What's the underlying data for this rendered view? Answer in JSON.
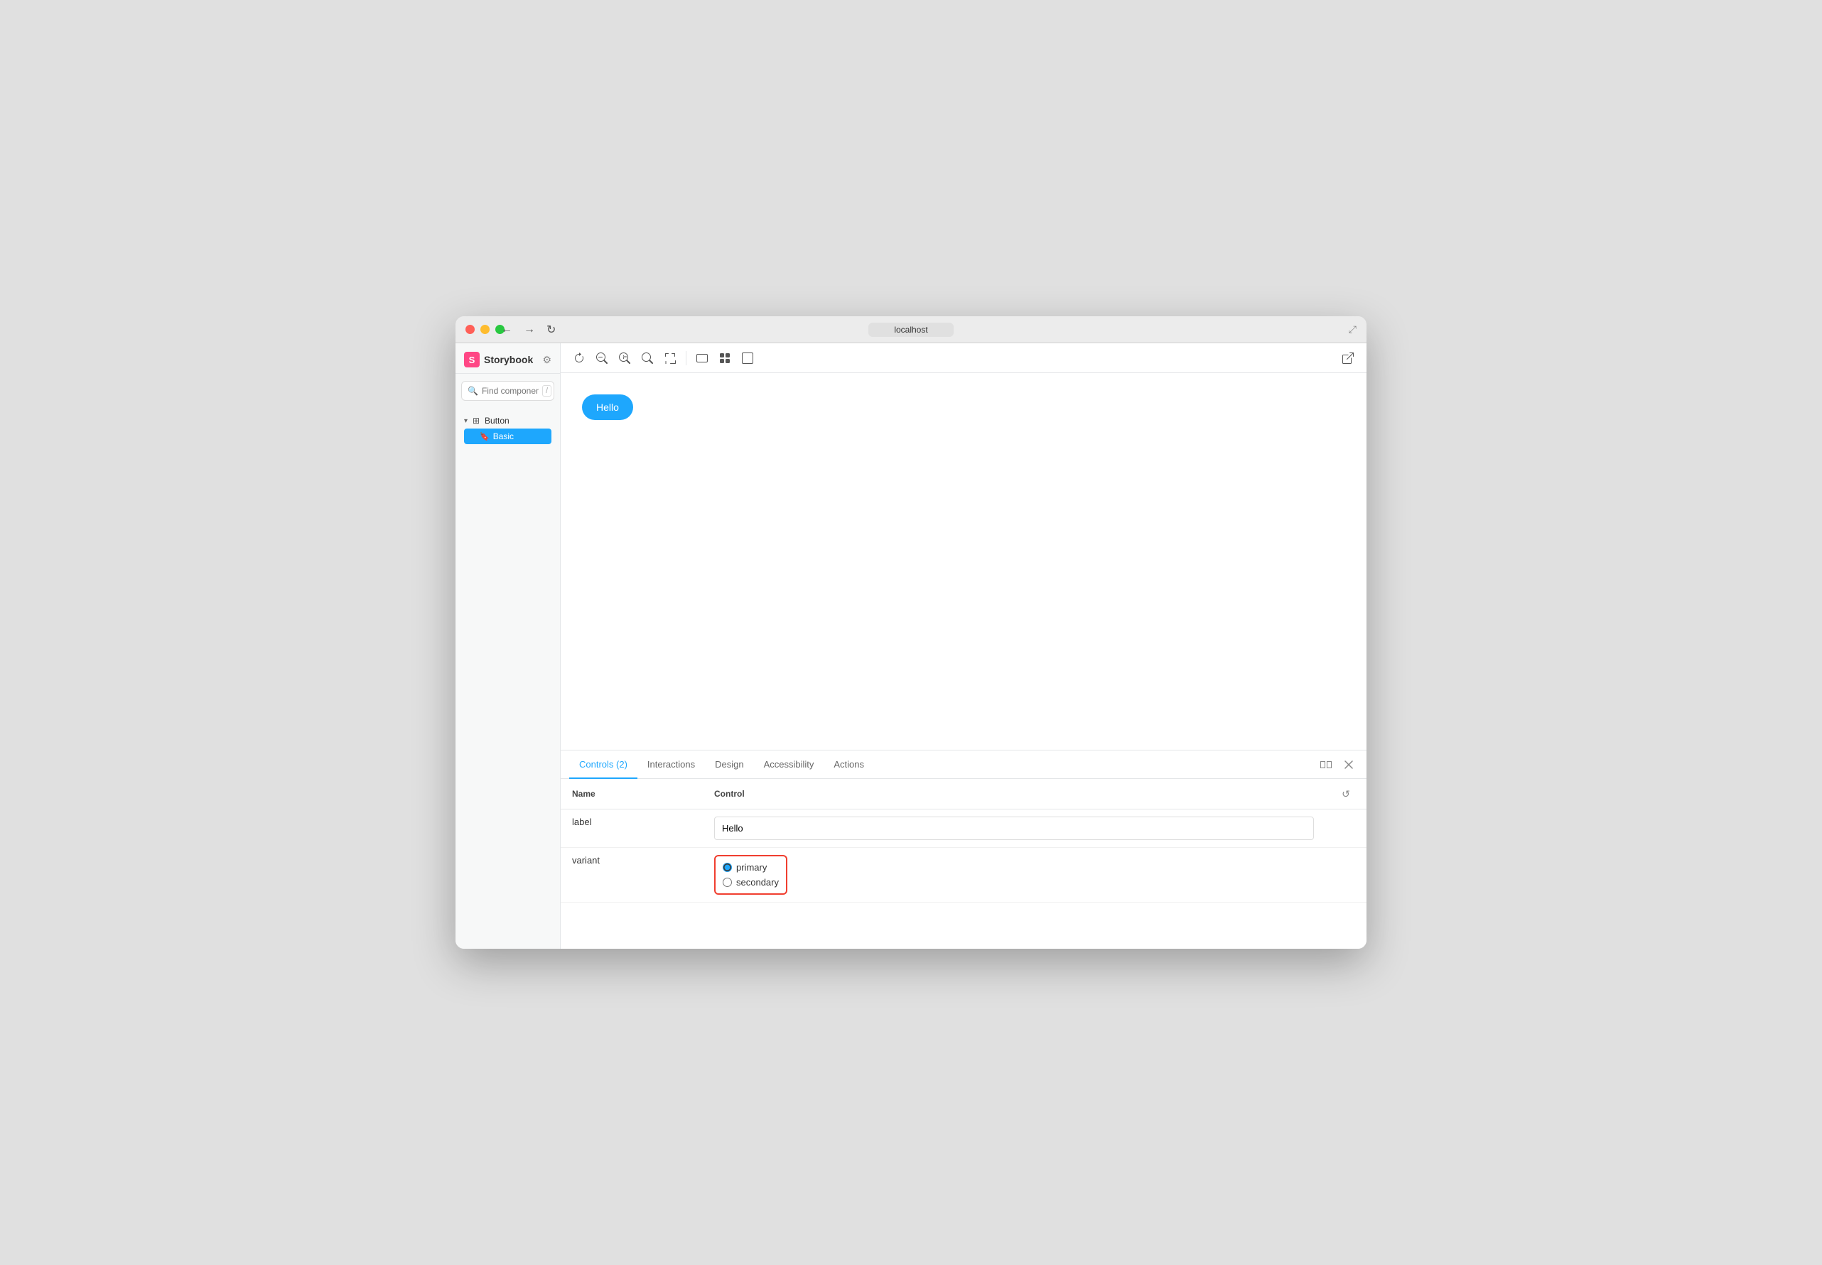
{
  "window": {
    "title": "localhost"
  },
  "titlebar": {
    "buttons": {
      "close": "close",
      "minimize": "minimize",
      "maximize": "maximize"
    },
    "nav": {
      "back": "←",
      "forward": "→",
      "refresh": "↻"
    },
    "url": "localhost",
    "external_icon": "⤢"
  },
  "sidebar": {
    "logo_letter": "S",
    "logo_text": "Storybook",
    "search_placeholder": "Find components",
    "search_shortcut": "/",
    "tree": {
      "group_label": "Button",
      "story_label": "Basic"
    }
  },
  "toolbar": {
    "buttons": [
      "↺",
      "⊖",
      "⊕",
      "⊙",
      "⊡",
      "⊞",
      "⊟"
    ]
  },
  "preview": {
    "button_label": "Hello"
  },
  "bottom_panel": {
    "tabs": [
      {
        "label": "Controls (2)",
        "active": true
      },
      {
        "label": "Interactions",
        "active": false
      },
      {
        "label": "Design",
        "active": false
      },
      {
        "label": "Accessibility",
        "active": false
      },
      {
        "label": "Actions",
        "active": false
      }
    ],
    "controls_table": {
      "col_name": "Name",
      "col_control": "Control",
      "rows": [
        {
          "name": "label",
          "control_type": "text",
          "value": "Hello"
        },
        {
          "name": "variant",
          "control_type": "radio",
          "options": [
            "primary",
            "secondary"
          ],
          "selected": "primary"
        }
      ]
    }
  }
}
